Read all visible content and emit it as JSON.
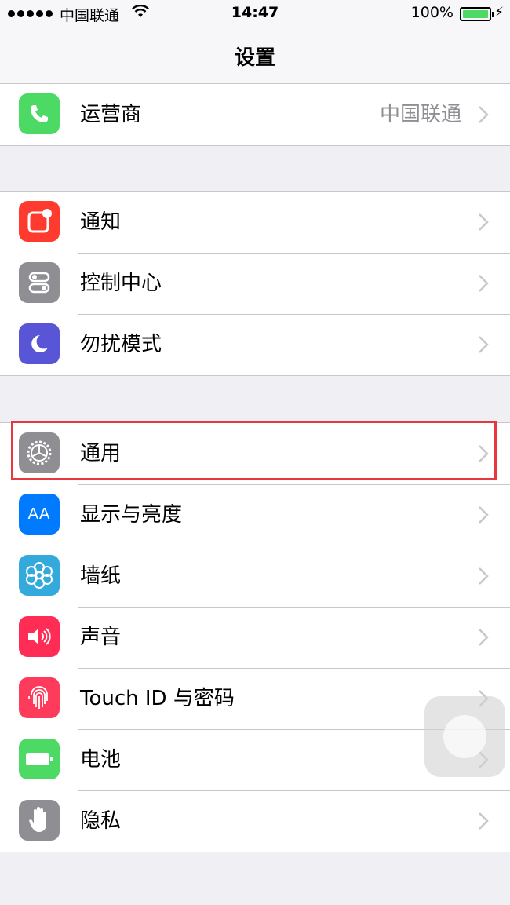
{
  "status_bar": {
    "carrier": "中国联通",
    "time": "14:47",
    "battery_percent": "100%",
    "battery_level": 1.0
  },
  "nav": {
    "title": "设置"
  },
  "groups": [
    {
      "rows": [
        {
          "label": "运营商",
          "detail": "中国联通",
          "icon": "phone-icon",
          "color": "#4cd964"
        }
      ]
    },
    {
      "rows": [
        {
          "label": "通知",
          "icon": "notification-icon",
          "color": "#ff3b30"
        },
        {
          "label": "控制中心",
          "icon": "control-center-icon",
          "color": "#8e8e93"
        },
        {
          "label": "勿扰模式",
          "icon": "moon-icon",
          "color": "#5856d6"
        }
      ]
    },
    {
      "rows": [
        {
          "label": "通用",
          "icon": "gear-icon",
          "color": "#8e8e93",
          "highlighted": true
        },
        {
          "label": "显示与亮度",
          "icon": "display-brightness-icon",
          "icon_text": "AA",
          "color": "#007aff"
        },
        {
          "label": "墙纸",
          "icon": "wallpaper-flower-icon",
          "color": "#34aadc"
        },
        {
          "label": "声音",
          "icon": "speaker-icon",
          "color": "#ff2d55"
        },
        {
          "label": "Touch ID 与密码",
          "icon": "fingerprint-icon",
          "color": "#ff3b5c"
        },
        {
          "label": "电池",
          "icon": "battery-icon",
          "color": "#4cd964"
        },
        {
          "label": "隐私",
          "icon": "hand-icon",
          "color": "#8e8e93"
        }
      ]
    }
  ]
}
